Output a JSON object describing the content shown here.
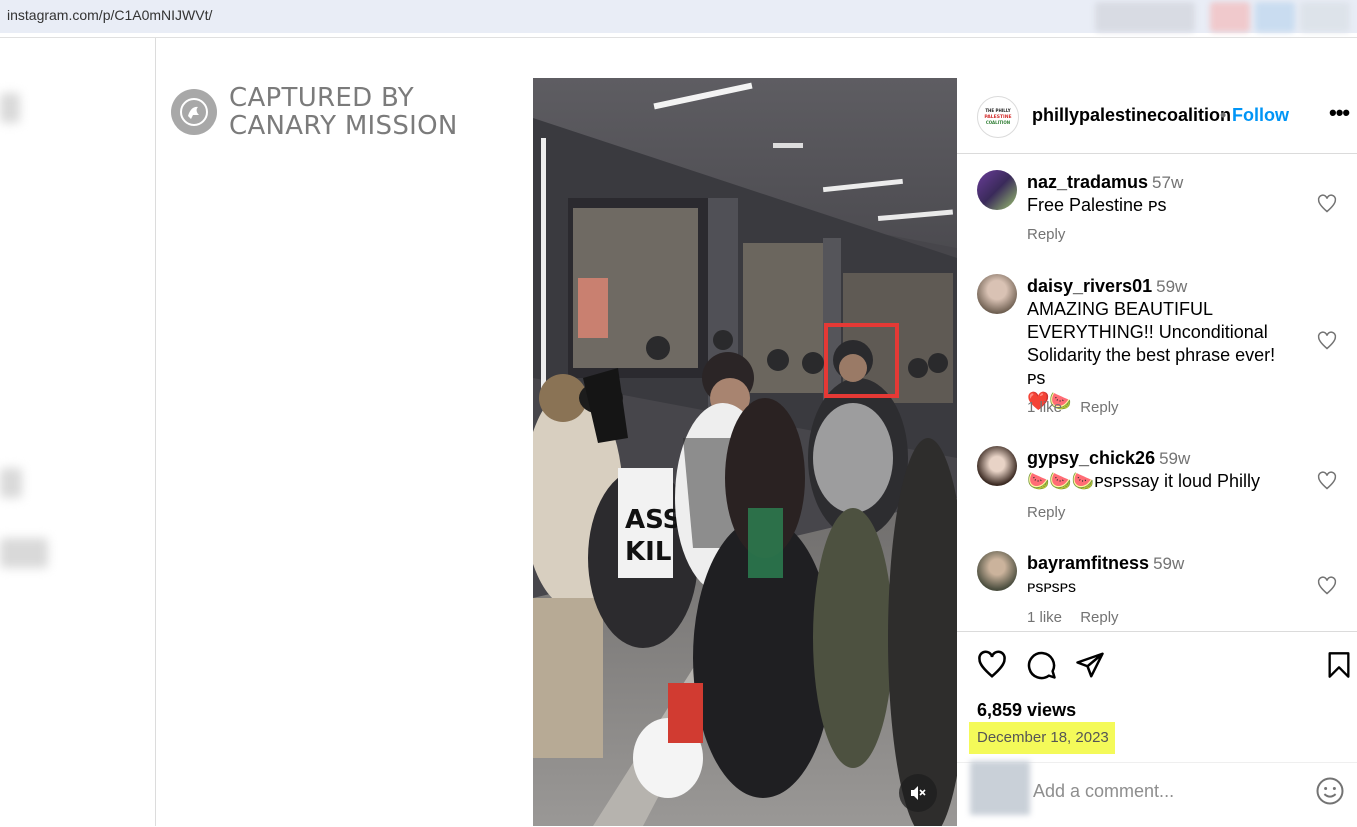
{
  "browser": {
    "url": "instagram.com/p/C1A0mNIJWVt/"
  },
  "watermark": {
    "line1": "CAPTURED BY",
    "line2": "CANARY MISSION"
  },
  "post": {
    "account": "phillypalestinecoalition",
    "separator": "•",
    "follow_label": "Follow",
    "more_label": "•••",
    "logo_text": [
      "THE PHILLY",
      "PALESTINE",
      "COALITION"
    ]
  },
  "comments": [
    {
      "user": "naz_tradamus",
      "time": "57w",
      "text": "Free Palestine ᴘs",
      "likes": "",
      "reply": "Reply"
    },
    {
      "user": "daisy_rivers01",
      "time": "59w",
      "text": "AMAZING BEAUTIFUL EVERYTHING!! Unconditional Solidarity the best phrase ever! ᴘs",
      "emoji": "❤️🍉",
      "likes": "1 like",
      "reply": "Reply"
    },
    {
      "user": "gypsy_chick26",
      "time": "59w",
      "text": "🍉🍉🍉ᴘsᴘssay it loud Philly",
      "likes": "",
      "reply": "Reply"
    },
    {
      "user": "bayramfitness",
      "time": "59w",
      "text": "ᴘsᴘsᴘs",
      "likes": "1 like",
      "reply": "Reply"
    }
  ],
  "footer": {
    "views": "6,859 views",
    "date": "December 18, 2023",
    "add_comment_placeholder": "Add a comment..."
  },
  "colors": {
    "accent": "#0095f6",
    "highlight": "#f4fa59",
    "face_box": "#e53935"
  }
}
